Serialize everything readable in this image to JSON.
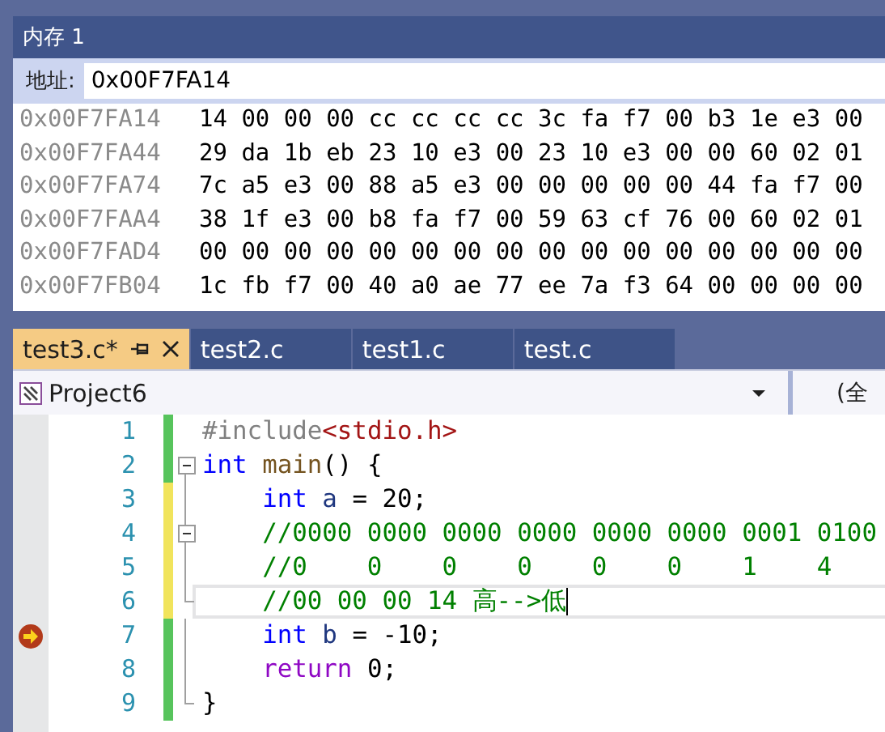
{
  "memory": {
    "title": "内存 1",
    "address_label": "地址:",
    "address": "0x00F7FA14",
    "rows": [
      {
        "address": "0x00F7FA14",
        "bytes": "14 00 00 00 cc cc cc cc 3c fa f7 00 b3 1e e3 00"
      },
      {
        "address": "0x00F7FA44",
        "bytes": "29 da 1b eb 23 10 e3 00 23 10 e3 00 00 60 02 01"
      },
      {
        "address": "0x00F7FA74",
        "bytes": "7c a5 e3 00 88 a5 e3 00 00 00 00 00 44 fa f7 00"
      },
      {
        "address": "0x00F7FAA4",
        "bytes": "38 1f e3 00 b8 fa f7 00 59 63 cf 76 00 60 02 01"
      },
      {
        "address": "0x00F7FAD4",
        "bytes": "00 00 00 00 00 00 00 00 00 00 00 00 00 00 00 00"
      },
      {
        "address": "0x00F7FB04",
        "bytes": "1c fb f7 00 40 a0 ae 77 ee 7a f3 64 00 00 00 00"
      }
    ]
  },
  "tabs": [
    {
      "label": "test3.c*",
      "selected": true
    },
    {
      "label": "test2.c",
      "selected": false
    },
    {
      "label": "test1.c",
      "selected": false
    },
    {
      "label": "test.c",
      "selected": false
    }
  ],
  "navigation": {
    "project": "Project6",
    "scope": "(全"
  },
  "editor": {
    "lines": [
      {
        "number": "1",
        "kind": "plain",
        "unsaved": false,
        "current_statement": false,
        "current": false,
        "tokens": [
          {
            "kind": "preprocessor",
            "text": "#include"
          },
          {
            "kind": "string",
            "text": "<stdio.h>"
          }
        ]
      },
      {
        "number": "2",
        "kind": "fold",
        "unsaved": false,
        "current_statement": false,
        "current": false,
        "tokens": [
          {
            "kind": "keyword",
            "text": "int"
          },
          {
            "kind": "function",
            "text": " main"
          },
          {
            "kind": "plain",
            "text": "() {"
          }
        ]
      },
      {
        "number": "3",
        "kind": "guide",
        "unsaved": true,
        "current_statement": false,
        "current": false,
        "tokens": [
          {
            "kind": "keyword",
            "text": "    int"
          },
          {
            "kind": "variable",
            "text": " a"
          },
          {
            "kind": "plain",
            "text": " = 20;"
          }
        ]
      },
      {
        "number": "4",
        "kind": "fold",
        "unsaved": true,
        "current_statement": false,
        "current": false,
        "tokens": [
          {
            "kind": "comment",
            "text": "    //0000 0000 0000 0000 0000 0000 0001 0100"
          }
        ]
      },
      {
        "number": "5",
        "kind": "guide",
        "unsaved": true,
        "current_statement": false,
        "current": false,
        "tokens": [
          {
            "kind": "comment",
            "text": "    //0    0    0    0    0    0    1    4"
          }
        ]
      },
      {
        "number": "6",
        "kind": "guide_end",
        "unsaved": true,
        "current_statement": false,
        "current": true,
        "tokens": [
          {
            "kind": "comment",
            "text": "    //00 00 00 14 高-->低"
          }
        ]
      },
      {
        "number": "7",
        "kind": "guide",
        "unsaved": false,
        "current_statement": true,
        "current": false,
        "tokens": [
          {
            "kind": "keyword",
            "text": "    int"
          },
          {
            "kind": "variable",
            "text": " b"
          },
          {
            "kind": "plain",
            "text": " = -10;"
          }
        ]
      },
      {
        "number": "8",
        "kind": "guide",
        "unsaved": false,
        "current_statement": false,
        "current": false,
        "tokens": [
          {
            "kind": "control",
            "text": "    return"
          },
          {
            "kind": "plain",
            "text": " 0;"
          }
        ]
      },
      {
        "number": "9",
        "kind": "guide_end",
        "unsaved": false,
        "current_statement": false,
        "current": false,
        "tokens": [
          {
            "kind": "plain",
            "text": "}"
          }
        ]
      }
    ]
  }
}
